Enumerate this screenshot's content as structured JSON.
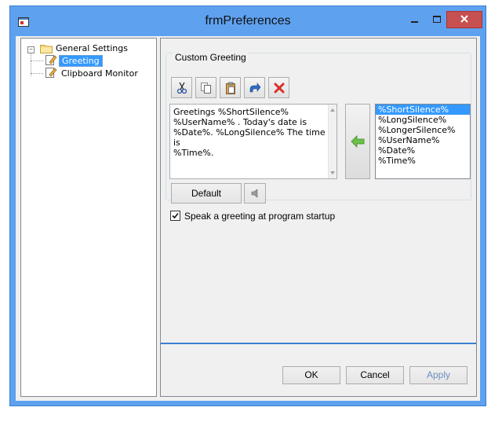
{
  "window": {
    "title": "frmPreferences"
  },
  "tree": {
    "root": "General Settings",
    "items": [
      {
        "label": "Greeting"
      },
      {
        "label": "Clipboard Monitor"
      }
    ]
  },
  "greeting": {
    "group_title": "Custom Greeting",
    "toolbar": [
      "cut-icon",
      "copy-icon",
      "paste-icon",
      "undo-icon",
      "delete-icon"
    ],
    "text_lines": [
      "Greetings %ShortSilence%",
      "%UserName% . Today's date is",
      "%Date%. %LongSilence% The time is",
      "%Time%."
    ],
    "variables": [
      "%ShortSilence%",
      "%LongSilence%",
      "%LongerSilence%",
      "%UserName%",
      "%Date%",
      "%Time%"
    ],
    "selected_variable": "%ShortSilence%",
    "default_label": "Default",
    "startup_label": "Speak a greeting at program startup",
    "startup_checked": true
  },
  "buttons": {
    "ok": "OK",
    "cancel": "Cancel",
    "apply": "Apply"
  },
  "colors": {
    "accent": "#5ea1ef",
    "selection": "#3399ff",
    "close": "#c75050"
  }
}
